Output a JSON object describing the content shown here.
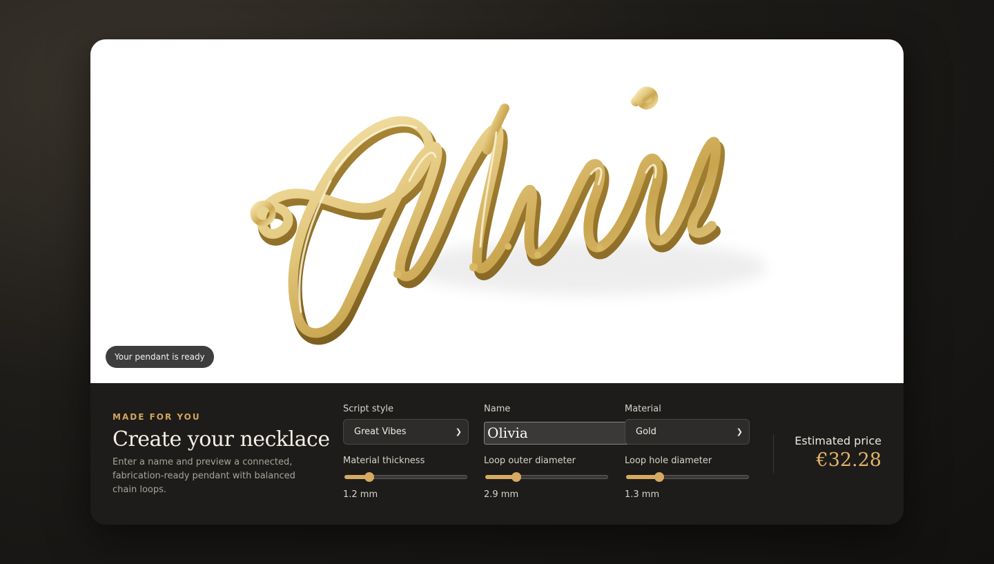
{
  "preview": {
    "status": "Your pendant is ready",
    "pendant_text": "Olivia"
  },
  "intro": {
    "eyebrow": "MADE FOR YOU",
    "title": "Create your necklace",
    "description": "Enter a name and preview a connected, fabrication-ready pendant with balanced chain loops."
  },
  "controls": {
    "script_style": {
      "label": "Script style",
      "value": "Great Vibes"
    },
    "name": {
      "label": "Name",
      "value": "Olivia"
    },
    "material": {
      "label": "Material",
      "value": "Gold"
    },
    "material_thickness": {
      "label": "Material thickness",
      "value": "1.2 mm",
      "level": 0.2
    },
    "loop_outer_diameter": {
      "label": "Loop outer diameter",
      "value": "2.9 mm",
      "level": 0.25
    },
    "loop_hole_diameter": {
      "label": "Loop hole diameter",
      "value": "1.3 mm",
      "level": 0.27
    }
  },
  "price": {
    "label": "Estimated price",
    "value": "€32.28"
  },
  "colors": {
    "accent": "#d6aa62",
    "gold_light": "#f3e3a8",
    "gold_dark": "#b8953e"
  },
  "icons": {
    "select_chevron": "chevron-down-icon"
  }
}
